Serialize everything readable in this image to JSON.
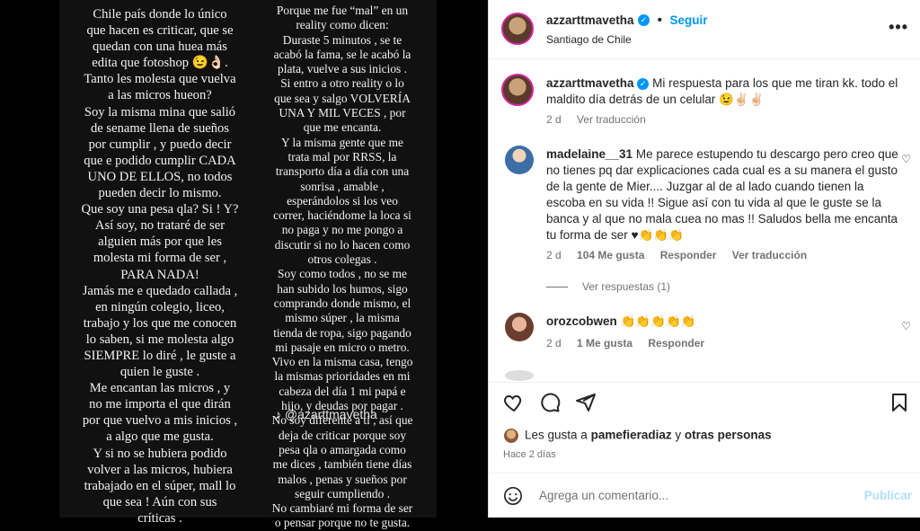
{
  "story": {
    "col1": "Chile país donde lo único\nque hacen es criticar, que se\nquedan con una huea más\nedita que fotoshop 😉👌🏻.\nTanto les molesta que vuelva\na las micros hueon?\nSoy la misma mina que salió\nde sename llena de sueños\npor cumplir , y puedo decir\nque e podido cumplir CADA\nUNO DE ELLOS, no todos\npueden decir lo mismo.\nQue soy una pesa qla? Si ! Y?\nAsí soy, no trataré de ser\nalguien más por que les\nmolesta mi forma de ser ,\nPARA NADA!\nJamás me e quedado callada ,\nen ningún colegio, liceo,\ntrabajo y los que me conocen\nlo saben, si me molesta algo\nSIEMPRE lo diré , le guste a\nquien le guste .\nMe encantan las micros , y\nno me importa el que dirán\npor que vuelvo a mis inicios ,\na algo que me gusta.\nY si no se hubiera podido\nvolver a las micros, hubiera\ntrabajado en el súper, mall lo\nque sea ! Aún con sus\ncríticas .",
    "col2": "Porque me fue “mal” en un\nreality como dicen:\nDuraste 5 minutos , se te\nacabó la fama, se le acabó la\nplata, vuelve a sus inicios .\nSi entro a otro reality o lo\nque sea y salgo VOLVERÍA\nUNA Y MIL VECES , por\nque me encanta.\nY la misma gente que me\ntrata mal por RRSS, la\ntransporto día a día con una\nsonrisa , amable ,\nesperándolos si los veo\ncorrer, haciéndome la loca si\nno paga y no me pongo a\ndiscutir si no lo hacen como\notros colegas .\nSoy como todos , no se me\nhan subido los humos, sigo\ncomprando donde mismo, el\nmismo súper , la misma\ntienda de ropa, sigo pagando\nmi pasaje en micro o metro.\nVivo en la misma casa, tengo\nla mismas prioridades en mi\ncabeza del día 1 mi papá e\nhijo, y deudas por pagar .\nNo soy diferente a ti , así que\ndeja de criticar porque soy\npesa qla o amargada como\nme dices , también tiene días\nmalos , penas y sueños por\nseguir cumpliendo .\nNo cambiaré mi forma de ser\no pensar porque no te gusta.",
    "watermark": "@azarttmavetha"
  },
  "header": {
    "username": "azzarttmavetha",
    "follow": "Seguir",
    "location": "Santiago de Chile"
  },
  "caption": {
    "username": "azzarttmavetha",
    "text": "Mi respuesta para los que me tiran kk. todo el maldito día detrás de un celular 😉✌🏻✌🏻",
    "time": "2 d",
    "translate": "Ver traducción"
  },
  "comments": [
    {
      "username": "madelaine__31",
      "text": "Me parece estupendo tu descargo pero creo que no tienes pq dar explicaciones cada cual es a su manera el gusto de la gente de Mier.... Juzgar al de al lado cuando tienen la escoba en su vida !! Sigue así con tu vida al que le guste se la banca y al que no mala cuea no mas !! Saludos bella me encanta tu forma de ser ♥👏👏👏",
      "time": "2 d",
      "likes": "104 Me gusta",
      "reply": "Responder",
      "translate": "Ver traducción",
      "view_replies": "Ver respuestas (1)"
    },
    {
      "username": "orozcobwen",
      "text": "👏👏👏👏👏",
      "time": "2 d",
      "likes": "1 Me gusta",
      "reply": "Responder"
    }
  ],
  "likes_line": {
    "prefix": "Les gusta a",
    "user": "pamefieradiaz",
    "mid": "y",
    "others": "otras personas"
  },
  "posted_ago": "Hace 2 días",
  "add_comment": {
    "placeholder": "Agrega un comentario...",
    "publish": "Publicar"
  },
  "colors": {
    "accent": "#0095f6",
    "story_bg": "#111111"
  }
}
